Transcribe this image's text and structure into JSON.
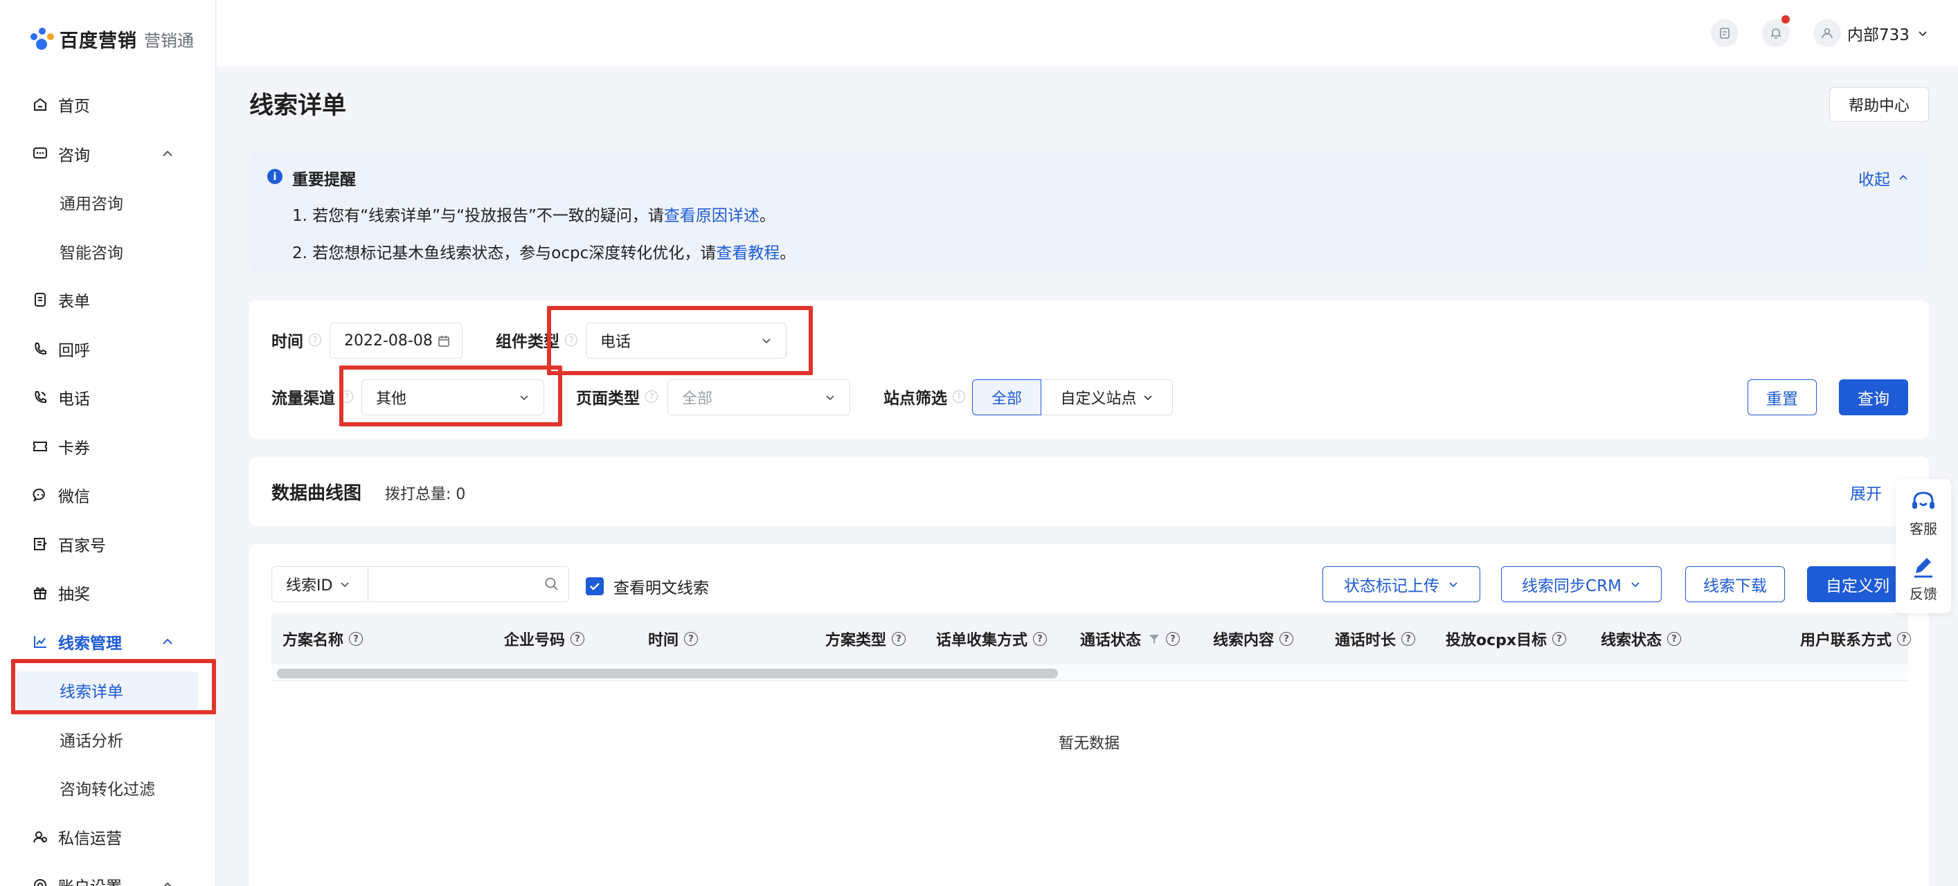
{
  "brand": {
    "name": "百度营销",
    "product": "营销通"
  },
  "sidebar": {
    "items": [
      {
        "label": "首页"
      },
      {
        "label": "咨询"
      },
      {
        "label": "通用咨询"
      },
      {
        "label": "智能咨询"
      },
      {
        "label": "表单"
      },
      {
        "label": "回呼"
      },
      {
        "label": "电话"
      },
      {
        "label": "卡券"
      },
      {
        "label": "微信"
      },
      {
        "label": "百家号"
      },
      {
        "label": "抽奖"
      },
      {
        "label": "线索管理"
      },
      {
        "label": "线索详单"
      },
      {
        "label": "通话分析"
      },
      {
        "label": "咨询转化过滤"
      },
      {
        "label": "私信运营"
      },
      {
        "label": "账户设置"
      }
    ]
  },
  "topbar": {
    "user": "内部733"
  },
  "page": {
    "title": "线索详单",
    "help": "帮助中心"
  },
  "notice": {
    "title": "重要提醒",
    "collapse": "收起",
    "line1_prefix": "1. 若您有“线索详单”与“投放报告”不一致的疑问，请",
    "line1_link": "查看原因详述",
    "line1_suffix": "。",
    "line2_prefix": "2. 若您想标记基木鱼线索状态，参与ocpc深度转化优化，请",
    "line2_link": "查看教程",
    "line2_suffix": "。"
  },
  "filters": {
    "time_label": "时间",
    "time_value": "2022-08-08",
    "component_label": "组件类型",
    "component_value": "电话",
    "channel_label": "流量渠道",
    "channel_value": "其他",
    "pagetype_label": "页面类型",
    "pagetype_value": "全部",
    "site_label": "站点筛选",
    "site_all": "全部",
    "site_custom": "自定义站点",
    "reset": "重置",
    "query": "查询"
  },
  "chart": {
    "title": "数据曲线图",
    "total": "拨打总量: 0",
    "expand": "展开"
  },
  "table": {
    "search_field": "线索ID",
    "search_placeholder": "",
    "show_plain": "查看明文线索",
    "actions": [
      "状态标记上传",
      "线索同步CRM",
      "线索下载",
      "自定义列"
    ],
    "columns": [
      "方案名称",
      "企业号码",
      "时间",
      "方案类型",
      "话单收集方式",
      "通话状态",
      "线索内容",
      "通话时长",
      "投放ocpx目标",
      "线索状态",
      "用户联系方式"
    ],
    "empty": "暂无数据"
  },
  "float_panel": {
    "service": "客服",
    "feedback": "反馈"
  },
  "colors": {
    "accent": "#1e5bd6",
    "highlight": "#e0352b"
  },
  "icons": [
    "home-icon",
    "chat-icon",
    "form-icon",
    "callback-icon",
    "phone-icon",
    "coupon-icon",
    "wechat-icon",
    "baijiahao-icon",
    "lottery-icon",
    "chart-icon",
    "dm-icon",
    "settings-icon",
    "calendar-icon",
    "search-icon",
    "bell-icon",
    "user-icon",
    "headset-icon",
    "edit-icon"
  ]
}
